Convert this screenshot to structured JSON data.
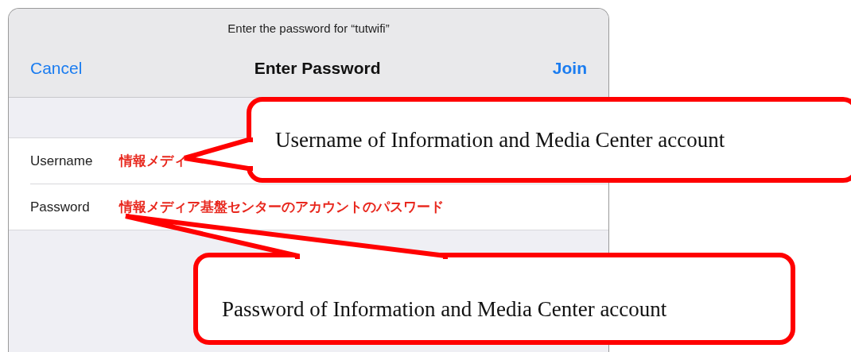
{
  "dialog": {
    "prompt": "Enter the password for “tutwifi”",
    "cancel": "Cancel",
    "title": "Enter Password",
    "join": "Join",
    "fields": [
      {
        "label": "Username",
        "value": "情報メディ"
      },
      {
        "label": "Password",
        "value": "情報メディア基盤センターのアカウントのパスワード"
      }
    ]
  },
  "callouts": [
    {
      "text": "Username of Information and Media Center account"
    },
    {
      "text": "Password of Information and Media Center account"
    }
  ]
}
